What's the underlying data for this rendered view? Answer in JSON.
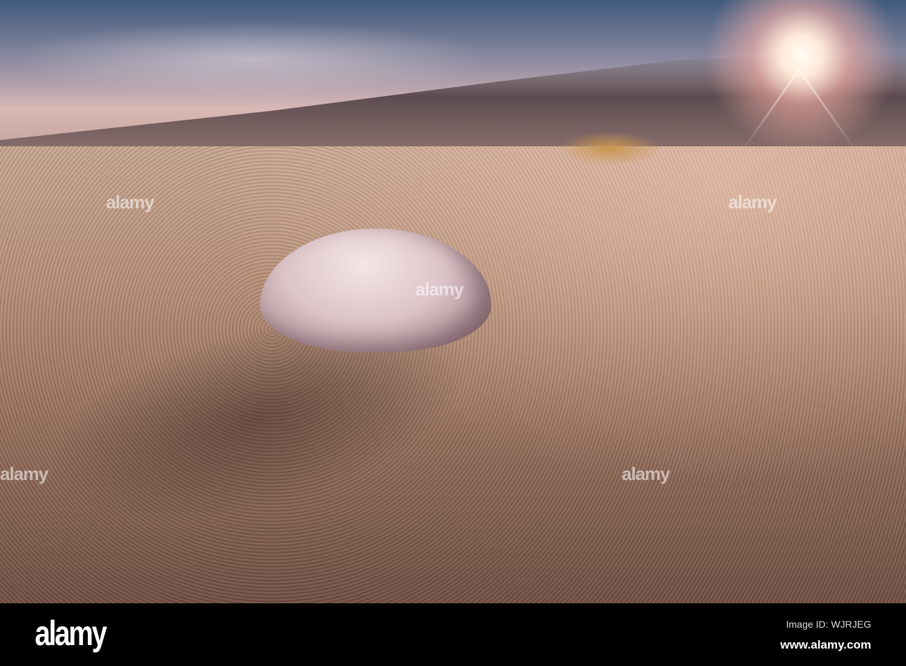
{
  "watermark": {
    "text": "alamy"
  },
  "footer": {
    "logo": "alamy",
    "image_id": "Image ID: WJRJEG",
    "website": "www.alamy.com"
  }
}
